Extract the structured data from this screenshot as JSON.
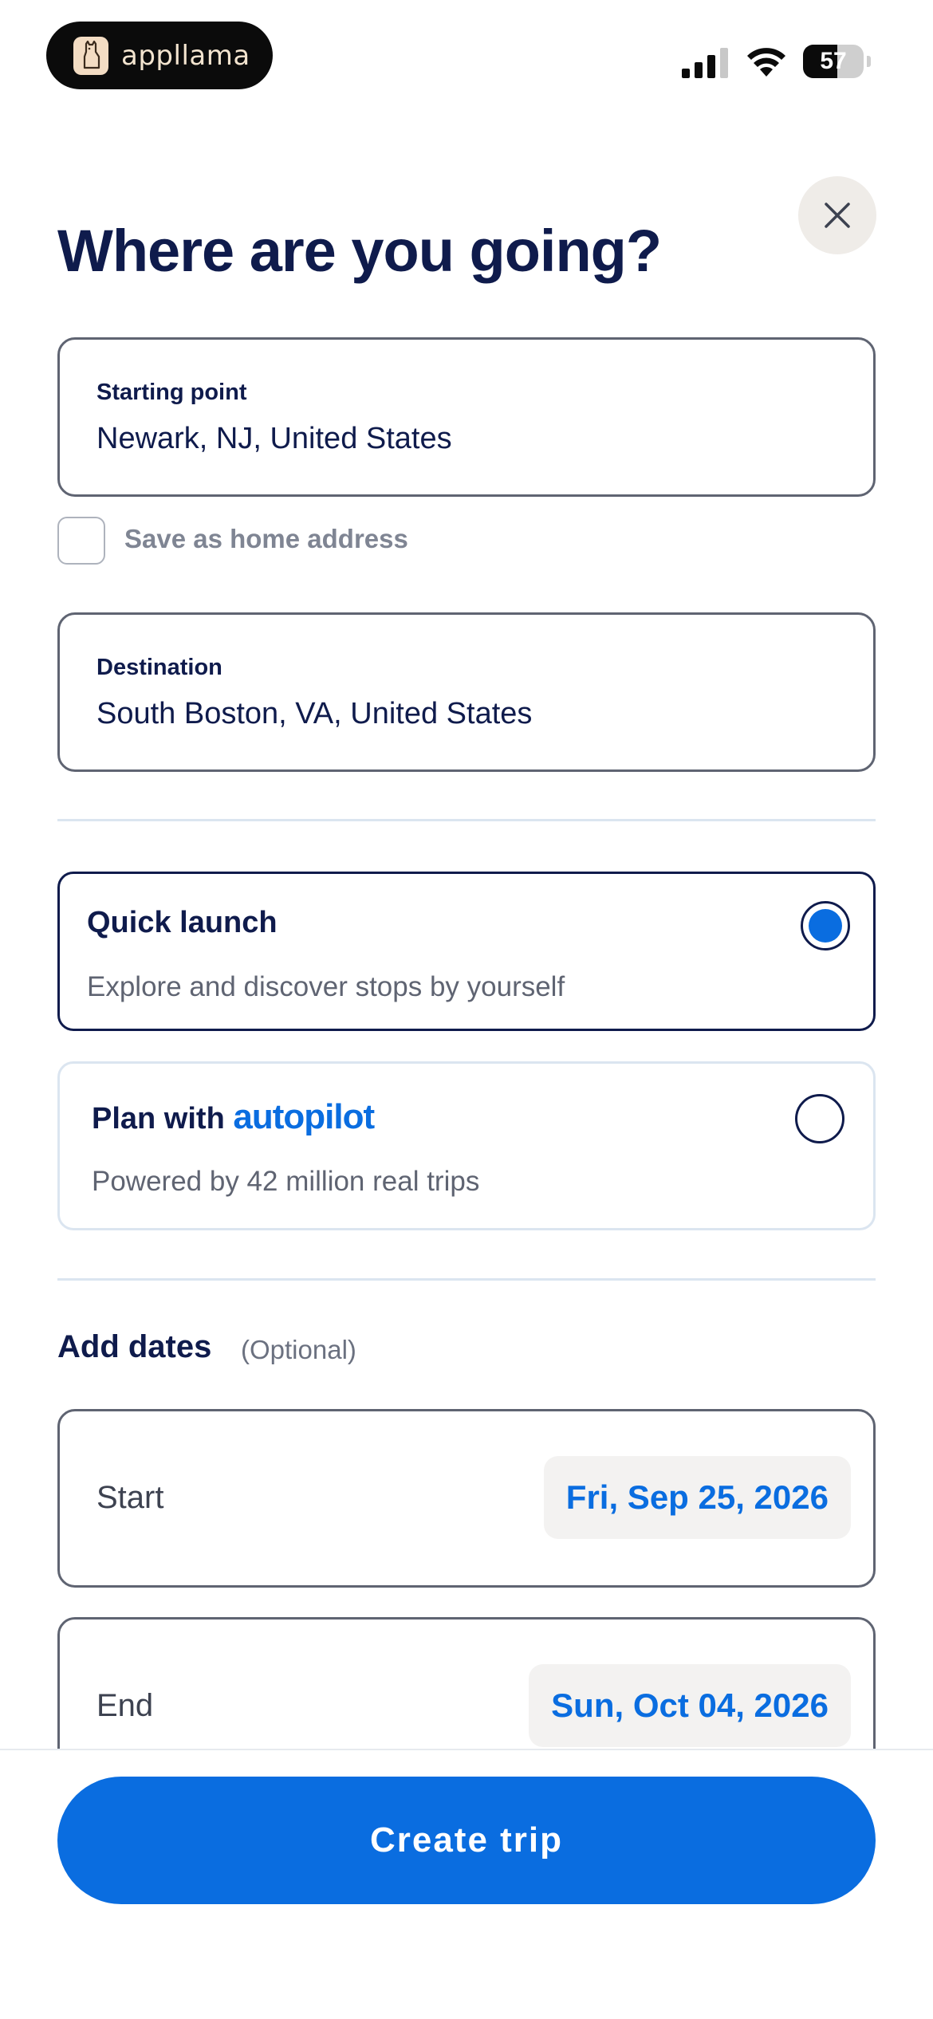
{
  "status_bar": {
    "app_name": "appllama",
    "battery_level": "57",
    "battery_percent": 57,
    "icons": [
      "signal-icon",
      "wifi-icon",
      "battery-icon"
    ]
  },
  "header": {
    "title": "Where are you going?",
    "close_icon": "close-icon"
  },
  "starting_point": {
    "label": "Starting point",
    "value": "Newark, NJ, United States"
  },
  "save_home": {
    "label": "Save as home address",
    "checked": false
  },
  "destination": {
    "label": "Destination",
    "value": "South Boston, VA, United States"
  },
  "options": {
    "quick_launch": {
      "title": "Quick launch",
      "subtitle": "Explore and discover stops by yourself",
      "selected": true
    },
    "autopilot": {
      "title_prefix": "Plan with",
      "brand": "autopilot",
      "subtitle": "Powered by 42 million real trips",
      "selected": false
    }
  },
  "dates": {
    "heading": "Add dates",
    "optional": "(Optional)",
    "start_label": "Start",
    "start_value": "Fri, Sep 25, 2026",
    "end_label": "End",
    "end_value": "Sun, Oct 04, 2026"
  },
  "footer": {
    "create_label": "Create trip"
  },
  "colors": {
    "accent": "#0a6de0",
    "text": "#0f1b4c",
    "border": "#5f6472"
  }
}
